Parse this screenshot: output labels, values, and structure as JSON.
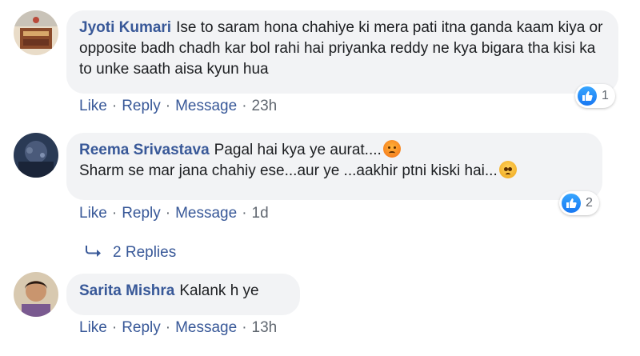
{
  "comments": [
    {
      "author": "Jyoti Kumari",
      "text": "Ise to saram hona chahiye ki mera pati itna ganda kaam kiya or opposite badh chadh kar bol rahi hai priyanka reddy ne kya bigara tha kisi ka to unke saath aisa kyun hua",
      "actions": {
        "like": "Like",
        "reply": "Reply",
        "message": "Message",
        "time": "23h"
      },
      "reaction_count": "1"
    },
    {
      "author": "Reema Srivastava",
      "text_line1": "Pagal hai kya ye aurat....",
      "text_line2": "Sharm se mar jana chahiy ese...aur ye ...aakhir ptni kiski hai...",
      "emoji1": "angry-face-emoji",
      "emoji2": "pleading-face-emoji",
      "actions": {
        "like": "Like",
        "reply": "Reply",
        "message": "Message",
        "time": "1d"
      },
      "reaction_count": "2",
      "replies_label": "2 Replies"
    },
    {
      "author": "Sarita Mishra",
      "text": "Kalank h ye",
      "actions": {
        "like": "Like",
        "reply": "Reply",
        "message": "Message",
        "time": "13h"
      }
    }
  ],
  "separator": "·",
  "colors": {
    "link": "#385898",
    "bubble": "#f2f3f5",
    "like_blue": "#1877f2"
  }
}
